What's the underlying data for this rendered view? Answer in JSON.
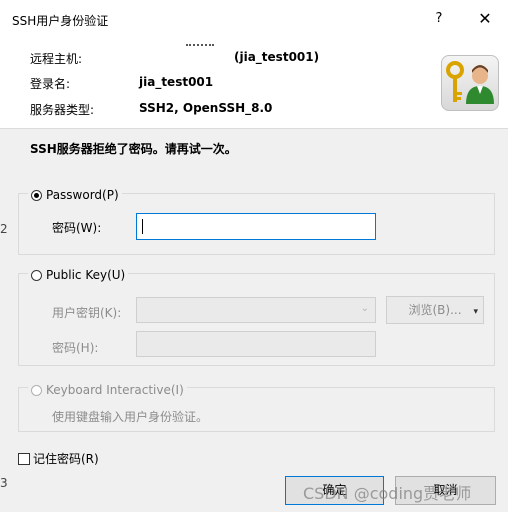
{
  "window": {
    "title": "SSH用户身份验证",
    "help_glyph": "?",
    "close_glyph": "✕"
  },
  "info": {
    "remote_host_label": "远程主机:",
    "remote_host_value": "(jia_test001)",
    "login_label": "登录名:",
    "login_value": "jia_test001",
    "server_type_label": "服务器类型:",
    "server_type_value": "SSH2, OpenSSH_8.0"
  },
  "icon": {
    "name": "key-user-icon"
  },
  "error_message": "SSH服务器拒绝了密码。请再试一次。",
  "password_group": {
    "option_label": "Password(P)",
    "selected": true,
    "field_label": "密码(W):",
    "field_value": ""
  },
  "publickey_group": {
    "option_label": "Public Key(U)",
    "selected": false,
    "key_label": "用户密钥(K):",
    "key_value": "",
    "browse_label": "浏览(B)...",
    "passphrase_label": "密码(H):",
    "passphrase_value": ""
  },
  "keyboard_group": {
    "option_label": "Keyboard Interactive(I)",
    "selected": false,
    "description": "使用键盘输入用户身份验证。"
  },
  "remember_password": {
    "label": "记住密码(R)",
    "checked": false
  },
  "buttons": {
    "ok": "确定",
    "cancel": "取消"
  },
  "watermark": "CSDN @coding贾老师",
  "edge_marks": {
    "left_top": "2",
    "left_bottom": "3"
  },
  "colors": {
    "focus_border": "#0078d7",
    "dialog_bg": "#f0f0f0",
    "header_bg": "#ffffff"
  }
}
